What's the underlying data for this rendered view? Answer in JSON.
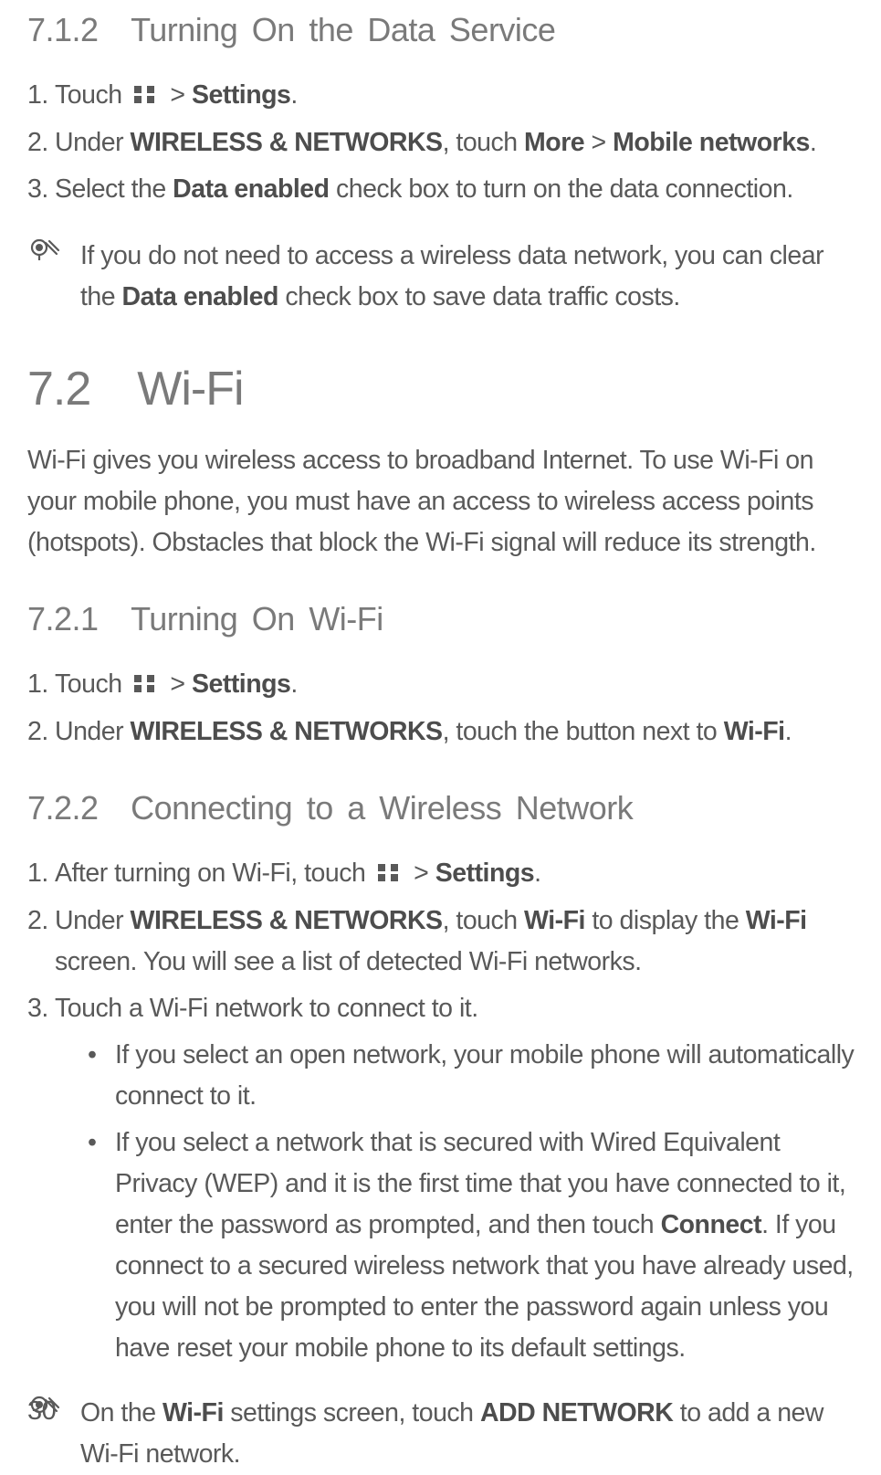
{
  "page_number": "30",
  "s712": {
    "heading": "7.1.2 Turning On the Data Service",
    "step1_pre": "Touch",
    "step1_post": " > ",
    "step1_bold": "Settings",
    "step1_tail": ".",
    "step2_pre": "Under ",
    "step2_b1": "WIRELESS & NETWORKS",
    "step2_mid1": ", touch ",
    "step2_b2": "More",
    "step2_mid2": " > ",
    "step2_b3": "Mobile networks",
    "step2_tail": ".",
    "step3_pre": "Select the ",
    "step3_b1": "Data enabled",
    "step3_tail": " check box to turn on the data connection.",
    "note_pre": "If you do not need to access a wireless data network, you can clear the ",
    "note_b1": "Data enabled",
    "note_tail": " check box to save data traffic costs."
  },
  "s72": {
    "heading": "7.2 Wi-Fi",
    "intro": "Wi-Fi gives you wireless access to broadband Internet. To use Wi-Fi on your mobile phone, you must have an access to wireless access points (hotspots). Obstacles that block the Wi-Fi signal will reduce its strength."
  },
  "s721": {
    "heading": "7.2.1 Turning On Wi-Fi",
    "step1_pre": "Touch",
    "step1_post": " > ",
    "step1_bold": "Settings",
    "step1_tail": ".",
    "step2_pre": "Under ",
    "step2_b1": "WIRELESS & NETWORKS",
    "step2_mid": ", touch the button next to ",
    "step2_b2": "Wi-Fi",
    "step2_tail": "."
  },
  "s722": {
    "heading": "7.2.2 Connecting to a Wireless Network",
    "step1_pre": "After turning on Wi-Fi, touch",
    "step1_post": " > ",
    "step1_bold": "Settings",
    "step1_tail": ".",
    "step2_pre": "Under ",
    "step2_b1": "WIRELESS & NETWORKS",
    "step2_mid1": ", touch ",
    "step2_b2": "Wi-Fi",
    "step2_mid2": " to display the ",
    "step2_b3": "Wi-Fi",
    "step2_tail": " screen. You will see a list of detected Wi-Fi networks.",
    "step3": "Touch a Wi-Fi network to connect to it.",
    "bullet1": "If you select an open network, your mobile phone will automatically connect to it.",
    "bullet2_pre": "If you select a network that is secured with Wired Equivalent Privacy (WEP) and it is the first time that you have connected to it, enter the password as prompted, and then touch ",
    "bullet2_b1": "Connect",
    "bullet2_tail": ". If you connect to a secured wireless network that you have already used, you will not be prompted to enter the password again unless you have reset your mobile phone to its default settings.",
    "note_pre": "On the ",
    "note_b1": "Wi-Fi",
    "note_mid": " settings screen, touch ",
    "note_b2": "ADD NETWORK",
    "note_tail": " to add a new Wi-Fi network."
  },
  "labels": {
    "n1": "1.",
    "n2": "2.",
    "n3": "3.",
    "bullet": "•"
  }
}
